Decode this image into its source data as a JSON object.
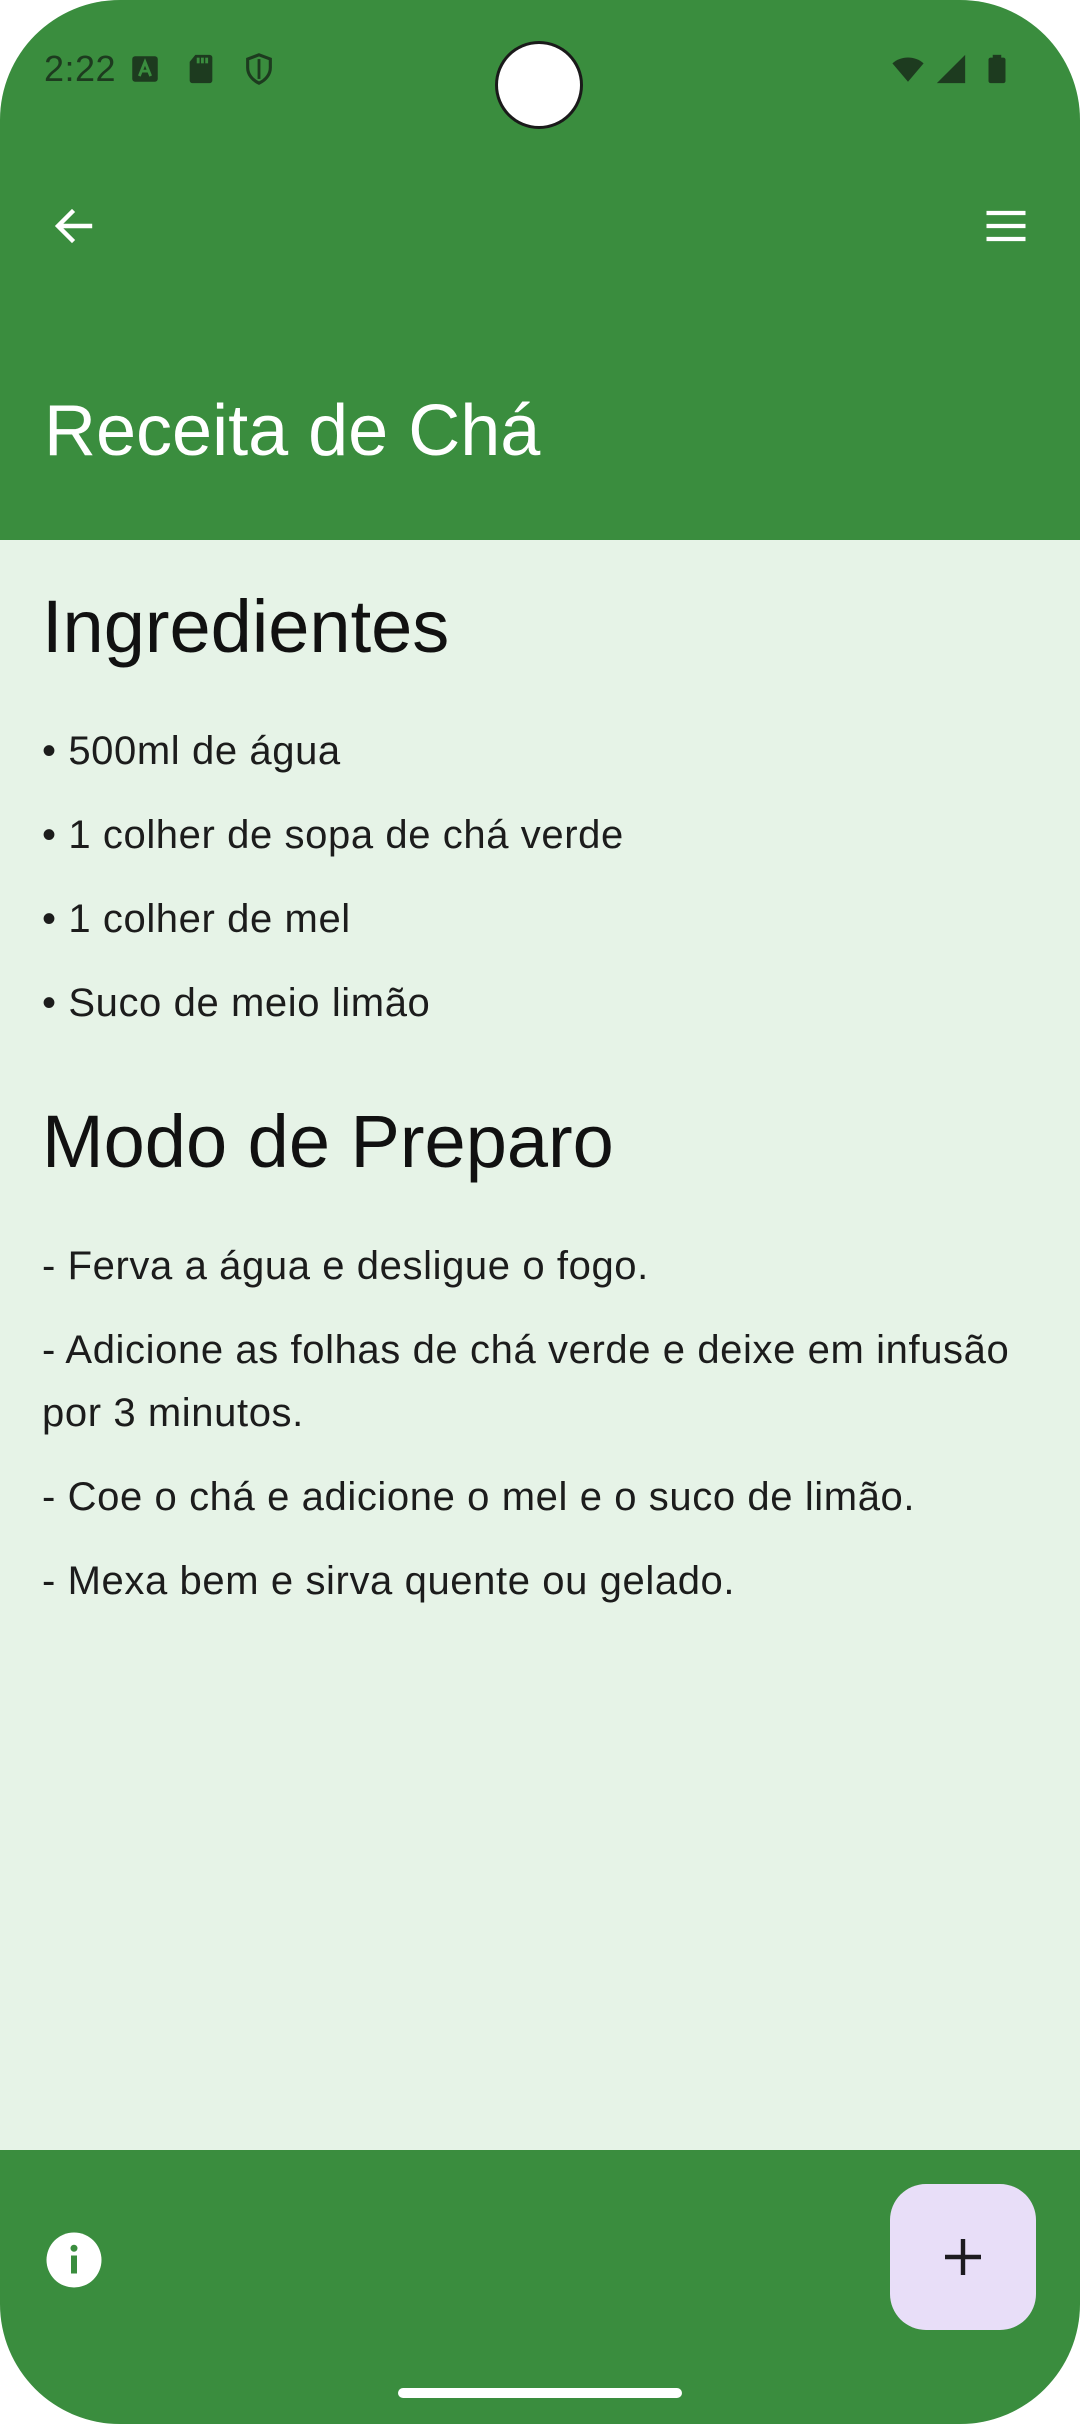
{
  "status_bar": {
    "time": "2:22",
    "icons": [
      "text-a-icon",
      "sd-card-icon",
      "shield-icon",
      "wifi-icon",
      "signal-icon",
      "battery-icon"
    ]
  },
  "app_bar": {
    "back_icon": "arrow-left-icon",
    "menu_icon": "hamburger-menu-icon",
    "title": "Receita de Chá"
  },
  "ingredients": {
    "heading": "Ingredientes",
    "items": [
      "• 500ml de água",
      "• 1 colher de sopa de chá verde",
      "• 1 colher de mel",
      "• Suco de meio limão"
    ]
  },
  "preparation": {
    "heading": "Modo de Preparo",
    "steps": [
      "- Ferva a água e desligue o fogo.",
      "- Adicione as folhas de chá verde e deixe em infusão",
      "por 3 minutos.",
      "- Coe o chá e adicione o mel e o suco de limão.",
      "- Mexa bem e sirva quente ou gelado."
    ]
  },
  "bottom_bar": {
    "info_icon": "info-icon",
    "fab_icon": "plus-icon"
  },
  "colors": {
    "primary": "#3a8d3e",
    "background": "#e6f3e7",
    "fab": "#e8def8"
  }
}
